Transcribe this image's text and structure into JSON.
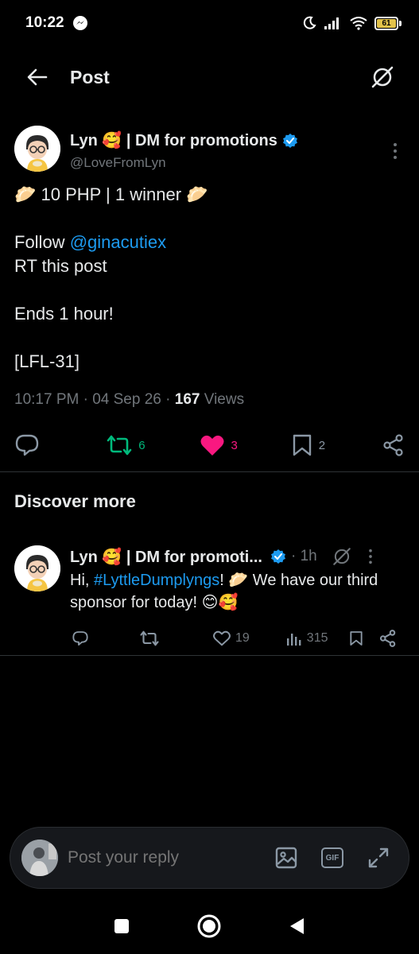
{
  "status": {
    "time": "10:22",
    "battery": "61"
  },
  "nav": {
    "title": "Post"
  },
  "post": {
    "author_name": "Lyn 🥰 | DM for promotions",
    "handle": "@LoveFromLyn",
    "lines": [
      "🥟 10 PHP | 1 winner 🥟",
      "",
      "Follow ",
      "RT this post",
      "",
      "Ends 1 hour!",
      "",
      "[LFL-31]"
    ],
    "mention": "@ginacutiex",
    "time": "10:17 PM",
    "date": "04 Sep 26",
    "views_count": "167",
    "views_label": "Views",
    "retweets": "6",
    "likes": "3",
    "bookmarks": "2"
  },
  "discover": {
    "title": "Discover more",
    "item": {
      "author_name": "Lyn 🥰 | DM for promoti...",
      "time": "1h",
      "text_pre": "Hi, ",
      "hashtag": "#LyttleDumplyngs",
      "text_post": "! 🥟 We have our third sponsor for today! 😊🥰",
      "likes": "19",
      "views": "315"
    }
  },
  "reply": {
    "placeholder": "Post your reply",
    "gif_label": "GIF"
  },
  "colors": {
    "accent": "#1d9bf0",
    "retweet": "#00ba7c",
    "like": "#f91880",
    "muted": "#71767b"
  }
}
